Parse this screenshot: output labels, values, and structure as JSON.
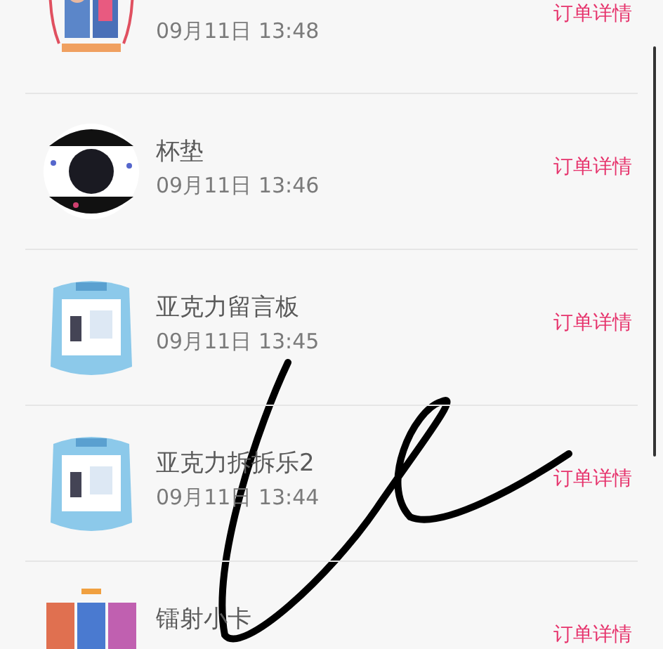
{
  "orders": [
    {
      "time": "09月11日 13:48",
      "action": "订单详情"
    },
    {
      "title": "杯垫",
      "time": "09月11日 13:46",
      "action": "订单详情"
    },
    {
      "title": "亚克力留言板",
      "time": "09月11日 13:45",
      "action": "订单详情"
    },
    {
      "title": "亚克力拆拆乐2",
      "time": "09月11日 13:44",
      "action": "订单详情"
    },
    {
      "title": "镭射小卡",
      "action": "订单详情"
    }
  ]
}
